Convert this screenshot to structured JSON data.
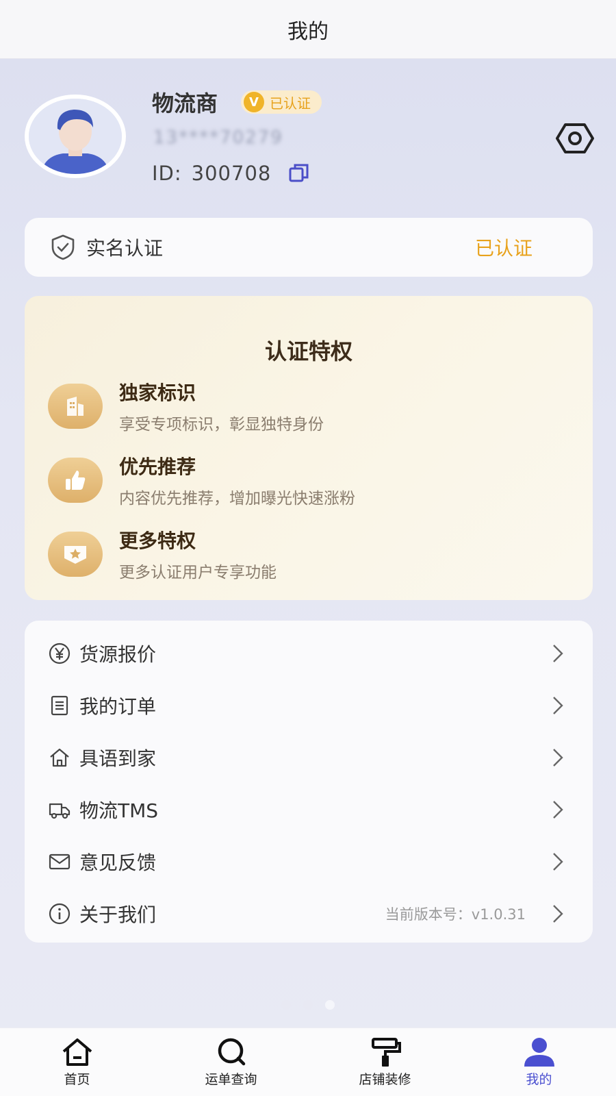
{
  "header": {
    "title": "我的"
  },
  "profile": {
    "name": "物流商",
    "verified_label": "已认证",
    "phone_masked": "13****70279",
    "id_label": "ID:",
    "id_value": "300708"
  },
  "realname": {
    "label": "实名认证",
    "status": "已认证"
  },
  "privileges": {
    "title": "认证特权",
    "items": [
      {
        "name": "独家标识",
        "desc": "享受专项标识，彰显独特身份",
        "icon": "building-icon"
      },
      {
        "name": "优先推荐",
        "desc": "内容优先推荐，增加曝光快速涨粉",
        "icon": "thumbs-up-icon"
      },
      {
        "name": "更多特权",
        "desc": "更多认证用户专享功能",
        "icon": "star-shield-icon"
      }
    ]
  },
  "menu": {
    "items": [
      {
        "label": "货源报价",
        "icon": "yen-circle-icon"
      },
      {
        "label": "我的订单",
        "icon": "order-list-icon"
      },
      {
        "label": "具语到家",
        "icon": "home-icon"
      },
      {
        "label": "物流TMS",
        "icon": "truck-icon"
      },
      {
        "label": "意见反馈",
        "icon": "mail-icon"
      },
      {
        "label": "关于我们",
        "icon": "info-icon",
        "extra": "当前版本号：v1.0.31"
      }
    ]
  },
  "tabbar": {
    "items": [
      {
        "label": "首页",
        "icon": "home-icon"
      },
      {
        "label": "运单查询",
        "icon": "search-icon"
      },
      {
        "label": "店铺装修",
        "icon": "paint-roller-icon"
      },
      {
        "label": "我的",
        "icon": "user-icon",
        "active": true
      }
    ]
  },
  "colors": {
    "accent": "#4a4fd0",
    "gold": "#e8a21c"
  }
}
